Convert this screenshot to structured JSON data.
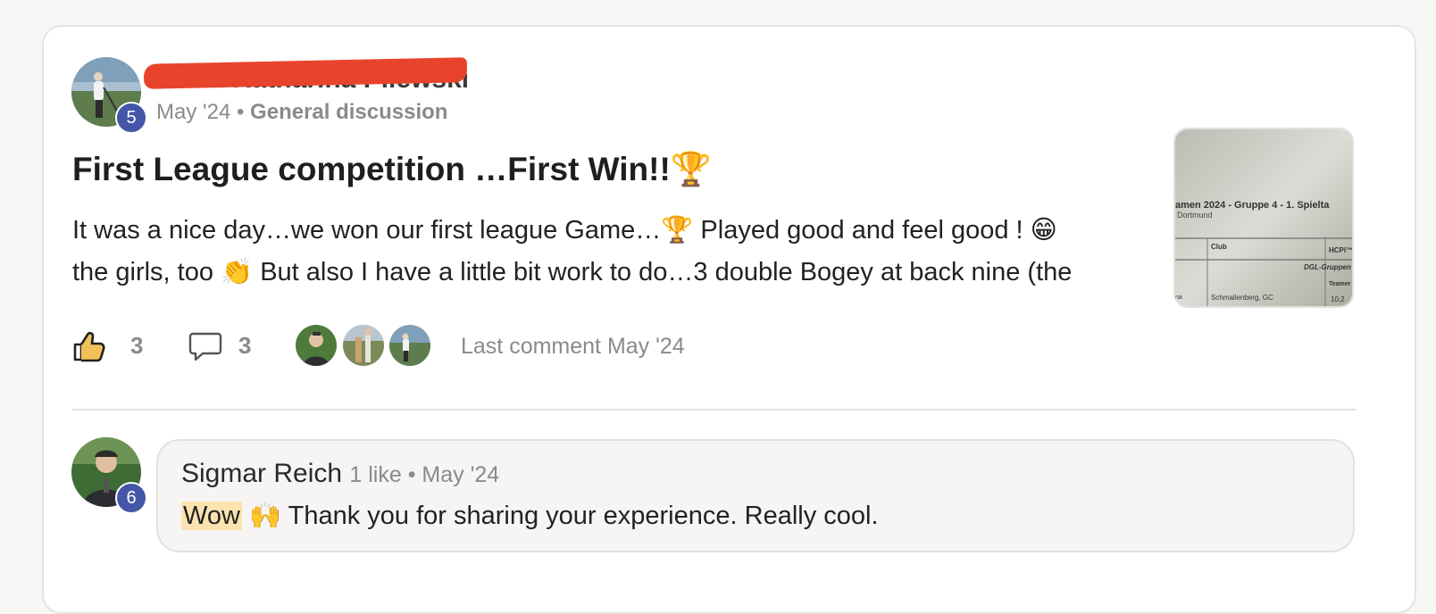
{
  "post": {
    "author_name": "Anna-Katharina Pilewski",
    "author_level": "5",
    "date": "May '24",
    "separator": "•",
    "category": "General discussion",
    "title": "First League competition …First Win!!",
    "title_emoji": "🏆",
    "excerpt_line1": "It was a nice day…we won our first league Game…🏆 Played good and feel good ! 😁",
    "excerpt_line2": "the girls, too 👏 But also I have a little bit work to do…3 double Bogey at back nine (the",
    "thumbnail": {
      "heading": "amen 2024 - Gruppe 4 - 1. Spielta",
      "sub": "Dortmund",
      "col_club": "Club",
      "col_hcp": "HCPI™",
      "group": "DGL-Gruppen",
      "team": "Teamer",
      "row_club": "Schmallenberg, GC",
      "row_prefix": "na",
      "row_value": "10,2"
    },
    "likes_count": "3",
    "comments_count": "3",
    "last_comment": "Last comment May '24"
  },
  "comment": {
    "author": "Sigmar Reich",
    "level": "6",
    "meta": "1 like • May '24",
    "highlight": "Wow",
    "emoji": "🙌",
    "text": " Thank you for sharing your experience. Really cool."
  },
  "colors": {
    "badge": "#4356a8",
    "redaction": "#e8442c",
    "highlight": "#fbe3b0"
  },
  "icons": [
    "thumbs-up-icon",
    "comment-bubble-icon"
  ]
}
